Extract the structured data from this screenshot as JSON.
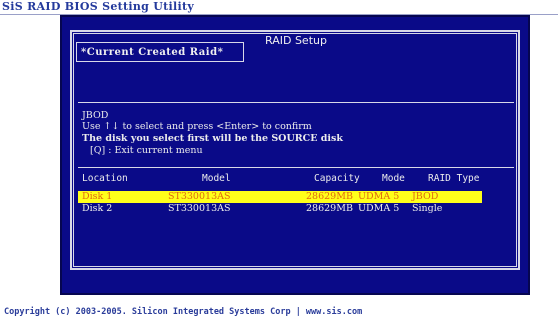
{
  "app_title": "SiS RAID BIOS Setting Utility",
  "window": {
    "title": "RAID Setup",
    "panel_title": "*Current Created Raid*"
  },
  "instructions": {
    "line1": "JBOD",
    "line2": "Use ↑↓ to select and press <Enter> to confirm",
    "line3": "The disk you select first will be the SOURCE disk",
    "line4": "[Q] : Exit current menu"
  },
  "table": {
    "headers": {
      "location": "Location",
      "model": "Model",
      "capacity": "Capacity",
      "mode": "Mode",
      "raid_type": "RAID Type"
    },
    "rows": [
      {
        "location": "Disk 1",
        "model": "ST330013AS",
        "capacity": "28629MB",
        "mode": "UDMA 5",
        "raid_type": "JBOD",
        "selected": true
      },
      {
        "location": "Disk 2",
        "model": "ST330013AS",
        "capacity": "28629MB",
        "mode": "UDMA 5",
        "raid_type": "Single",
        "selected": false
      }
    ]
  },
  "footer": "Copyright (c) 2003-2005. Silicon Integrated Systems Corp   |   www.sis.com",
  "colors": {
    "screen_bg": "#0a0a88",
    "text": "#ececec",
    "highlight_bg": "#ffff1a",
    "highlight_text": "#e06a10",
    "title_text": "#243a9c"
  }
}
